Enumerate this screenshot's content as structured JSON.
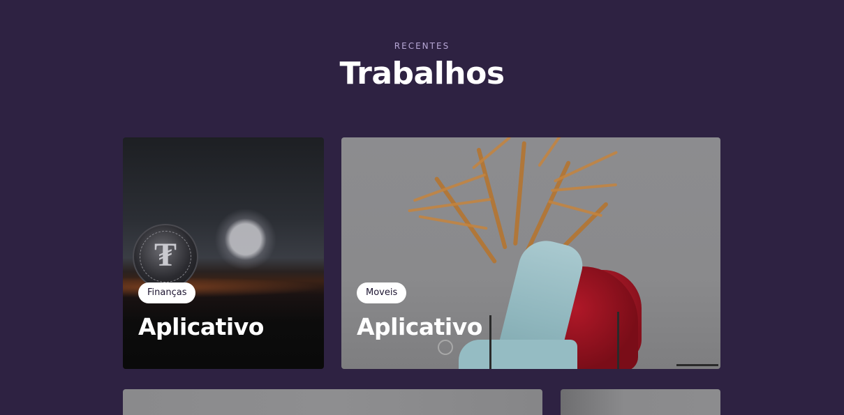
{
  "section": {
    "eyebrow": "RECENTES",
    "title": "Trabalhos"
  },
  "cards": [
    {
      "tag": "Finanças",
      "title": "Aplicativo",
      "image_icon": "bitcoin-coin-icon"
    },
    {
      "tag": "Moveis",
      "title": "Aplicativo",
      "image_icon": "chair-plant-image"
    }
  ],
  "colors": {
    "background": "#2e2242",
    "eyebrow": "#b8a8d6",
    "tag_bg": "#ffffff",
    "tag_text": "#1c1430"
  }
}
